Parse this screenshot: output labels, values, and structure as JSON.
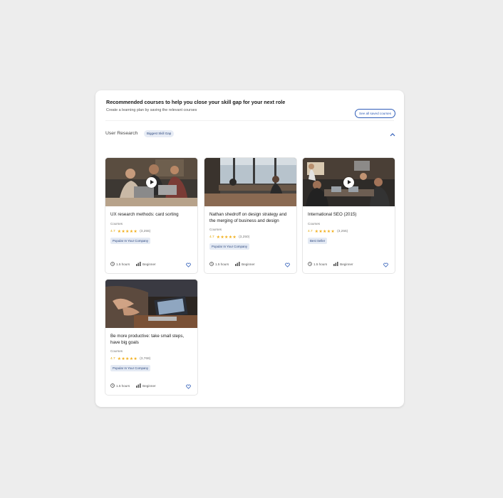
{
  "header": {
    "title": "Recommended courses to help you close your skill gap for your next role",
    "subtitle": "Create a learning plan by saving the relevant courses",
    "see_all_label": "See all saved courses"
  },
  "section": {
    "label": "User Research",
    "badge": "Biggest Skill Gap",
    "collapse_icon": "chevron-up-icon"
  },
  "colors": {
    "accent": "#2f5db8",
    "star": "#f2b01e",
    "tag_bg": "#e4eaf4"
  },
  "courses": [
    {
      "title": "UX research methods: card sorting",
      "type": "Courses",
      "rating": "4.7",
      "stars": "★★★★★",
      "reviews": "(3,255)",
      "tag": "Popular In Your Company",
      "duration": "1.5 hours",
      "level": "Beginner",
      "has_play": true
    },
    {
      "title": "Nathan shedroff on design strategy and the merging of business and design",
      "type": "Courses",
      "rating": "4.7",
      "stars": "★★★★★",
      "reviews": "(3,250)",
      "tag": "Popular In Your Company",
      "duration": "1.5 hours",
      "level": "Beginner",
      "has_play": false
    },
    {
      "title": "International SEO (2015)",
      "type": "Courses",
      "rating": "4.7",
      "stars": "★★★★★",
      "reviews": "(3,255)",
      "tag": "Best Seller",
      "duration": "1.5 hours",
      "level": "Beginner",
      "has_play": true
    },
    {
      "title": "Be more productive: take small steps, have big goals",
      "type": "Courses",
      "rating": "4.7",
      "stars": "★★★★★",
      "reviews": "(3,768)",
      "tag": "Popular In Your Company",
      "duration": "1.5 hours",
      "level": "Beginner",
      "has_play": false
    }
  ]
}
